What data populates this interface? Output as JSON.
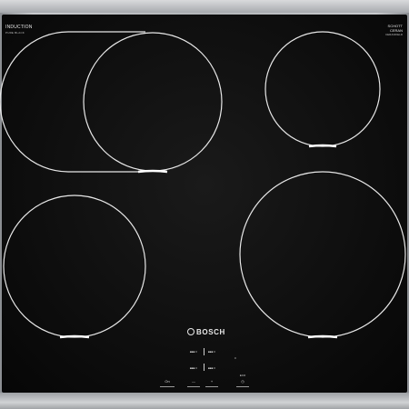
{
  "product": {
    "brand": "BOSCH",
    "label_left": "INDUCTION",
    "label_left_sub": "PURE BLACK",
    "label_right": "SCHOTT",
    "label_right_2": "CERAN",
    "label_right_sub": "CERANFIELD"
  },
  "controls": {
    "zone_labels": [
      "■■■ II",
      "■■■ II",
      "■■■ II",
      "■■■ II"
    ],
    "side_mark": "0",
    "power_label": "On",
    "minus_label": "—",
    "plus_label": "+",
    "timer_label": "◷",
    "timer_sub": "ECO"
  },
  "colors": {
    "glass": "#0c0c0c",
    "zone_outline": "#e8e8e8",
    "frame": "#b3b6b9"
  }
}
